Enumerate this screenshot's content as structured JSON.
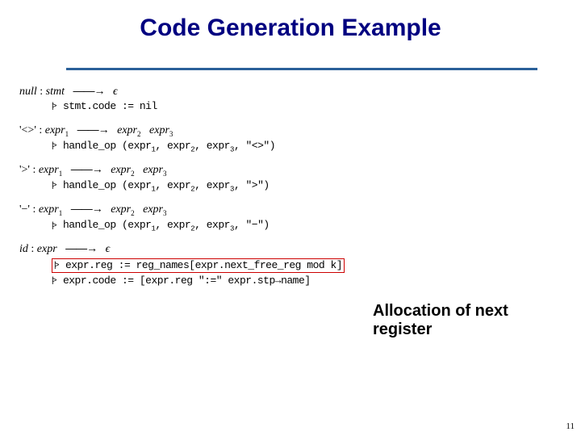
{
  "title": "Code Generation Example",
  "callout": "Allocation of next register",
  "page_number": "11",
  "glyphs": {
    "arrow": "——→",
    "tri": "|>",
    "eps": "ϵ",
    "assign": ":=",
    "mapsto": "→"
  },
  "rules": {
    "r0": {
      "label": "null",
      "lhs": "stmt",
      "rhs_eps": true,
      "actions": {
        "a0": "stmt.code := nil"
      }
    },
    "r1": {
      "label": "'<>'",
      "lhs": "expr",
      "lhs_sub": "1",
      "rhs": [
        {
          "sym": "expr",
          "sub": "2"
        },
        {
          "sym": "expr",
          "sub": "3"
        }
      ],
      "actions": {
        "a0": {
          "fn": "handle_op",
          "args": [
            {
              "sym": "expr",
              "sub": "1"
            },
            {
              "sym": "expr",
              "sub": "2"
            },
            {
              "sym": "expr",
              "sub": "3"
            }
          ],
          "lit": "\"<>\""
        }
      }
    },
    "r2": {
      "label": "'>'",
      "lhs": "expr",
      "lhs_sub": "1",
      "rhs": [
        {
          "sym": "expr",
          "sub": "2"
        },
        {
          "sym": "expr",
          "sub": "3"
        }
      ],
      "actions": {
        "a0": {
          "fn": "handle_op",
          "args": [
            {
              "sym": "expr",
              "sub": "1"
            },
            {
              "sym": "expr",
              "sub": "2"
            },
            {
              "sym": "expr",
              "sub": "3"
            }
          ],
          "lit": "\">\""
        }
      }
    },
    "r3": {
      "label": "'−'",
      "lhs": "expr",
      "lhs_sub": "1",
      "rhs": [
        {
          "sym": "expr",
          "sub": "2"
        },
        {
          "sym": "expr",
          "sub": "3"
        }
      ],
      "actions": {
        "a0": {
          "fn": "handle_op",
          "args": [
            {
              "sym": "expr",
              "sub": "1"
            },
            {
              "sym": "expr",
              "sub": "2"
            },
            {
              "sym": "expr",
              "sub": "3"
            }
          ],
          "lit": "\"−\""
        }
      }
    },
    "r4": {
      "label": "id",
      "lhs": "expr",
      "rhs_eps": true,
      "actions": {
        "a0": "expr.reg := reg_names[expr.next_free_reg mod k]",
        "a1": "expr.code := [expr.reg \":=\" expr.stp→name]"
      }
    }
  }
}
